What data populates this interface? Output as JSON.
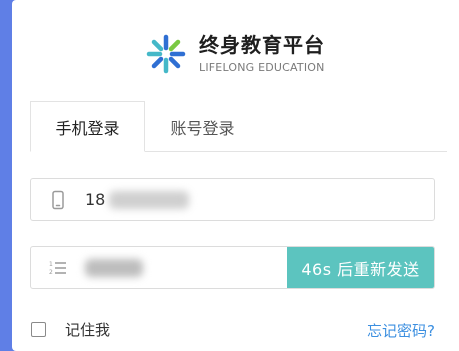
{
  "brand": {
    "name_cn": "终身教育平台",
    "name_en": "LIFELONG EDUCATION",
    "logo_icon": "asterisk-logo-icon",
    "logo_colors": [
      "#2f6fd3",
      "#45b8c8",
      "#7ac943"
    ]
  },
  "tabs": [
    {
      "label": "手机登录",
      "active": true
    },
    {
      "label": "账号登录",
      "active": false
    }
  ],
  "phone_field": {
    "icon": "phone-icon",
    "value": "18",
    "masked": true
  },
  "code_field": {
    "icon": "code-list-icon",
    "value": "",
    "masked": true,
    "send_button_label": "46s 后重新发送"
  },
  "remember": {
    "label": "记住我",
    "checked": false
  },
  "forgot_label": "忘记密码?",
  "colors": {
    "background": "#5f7fe6",
    "accent_button": "#5cc4bf",
    "link": "#3c8fe0"
  }
}
